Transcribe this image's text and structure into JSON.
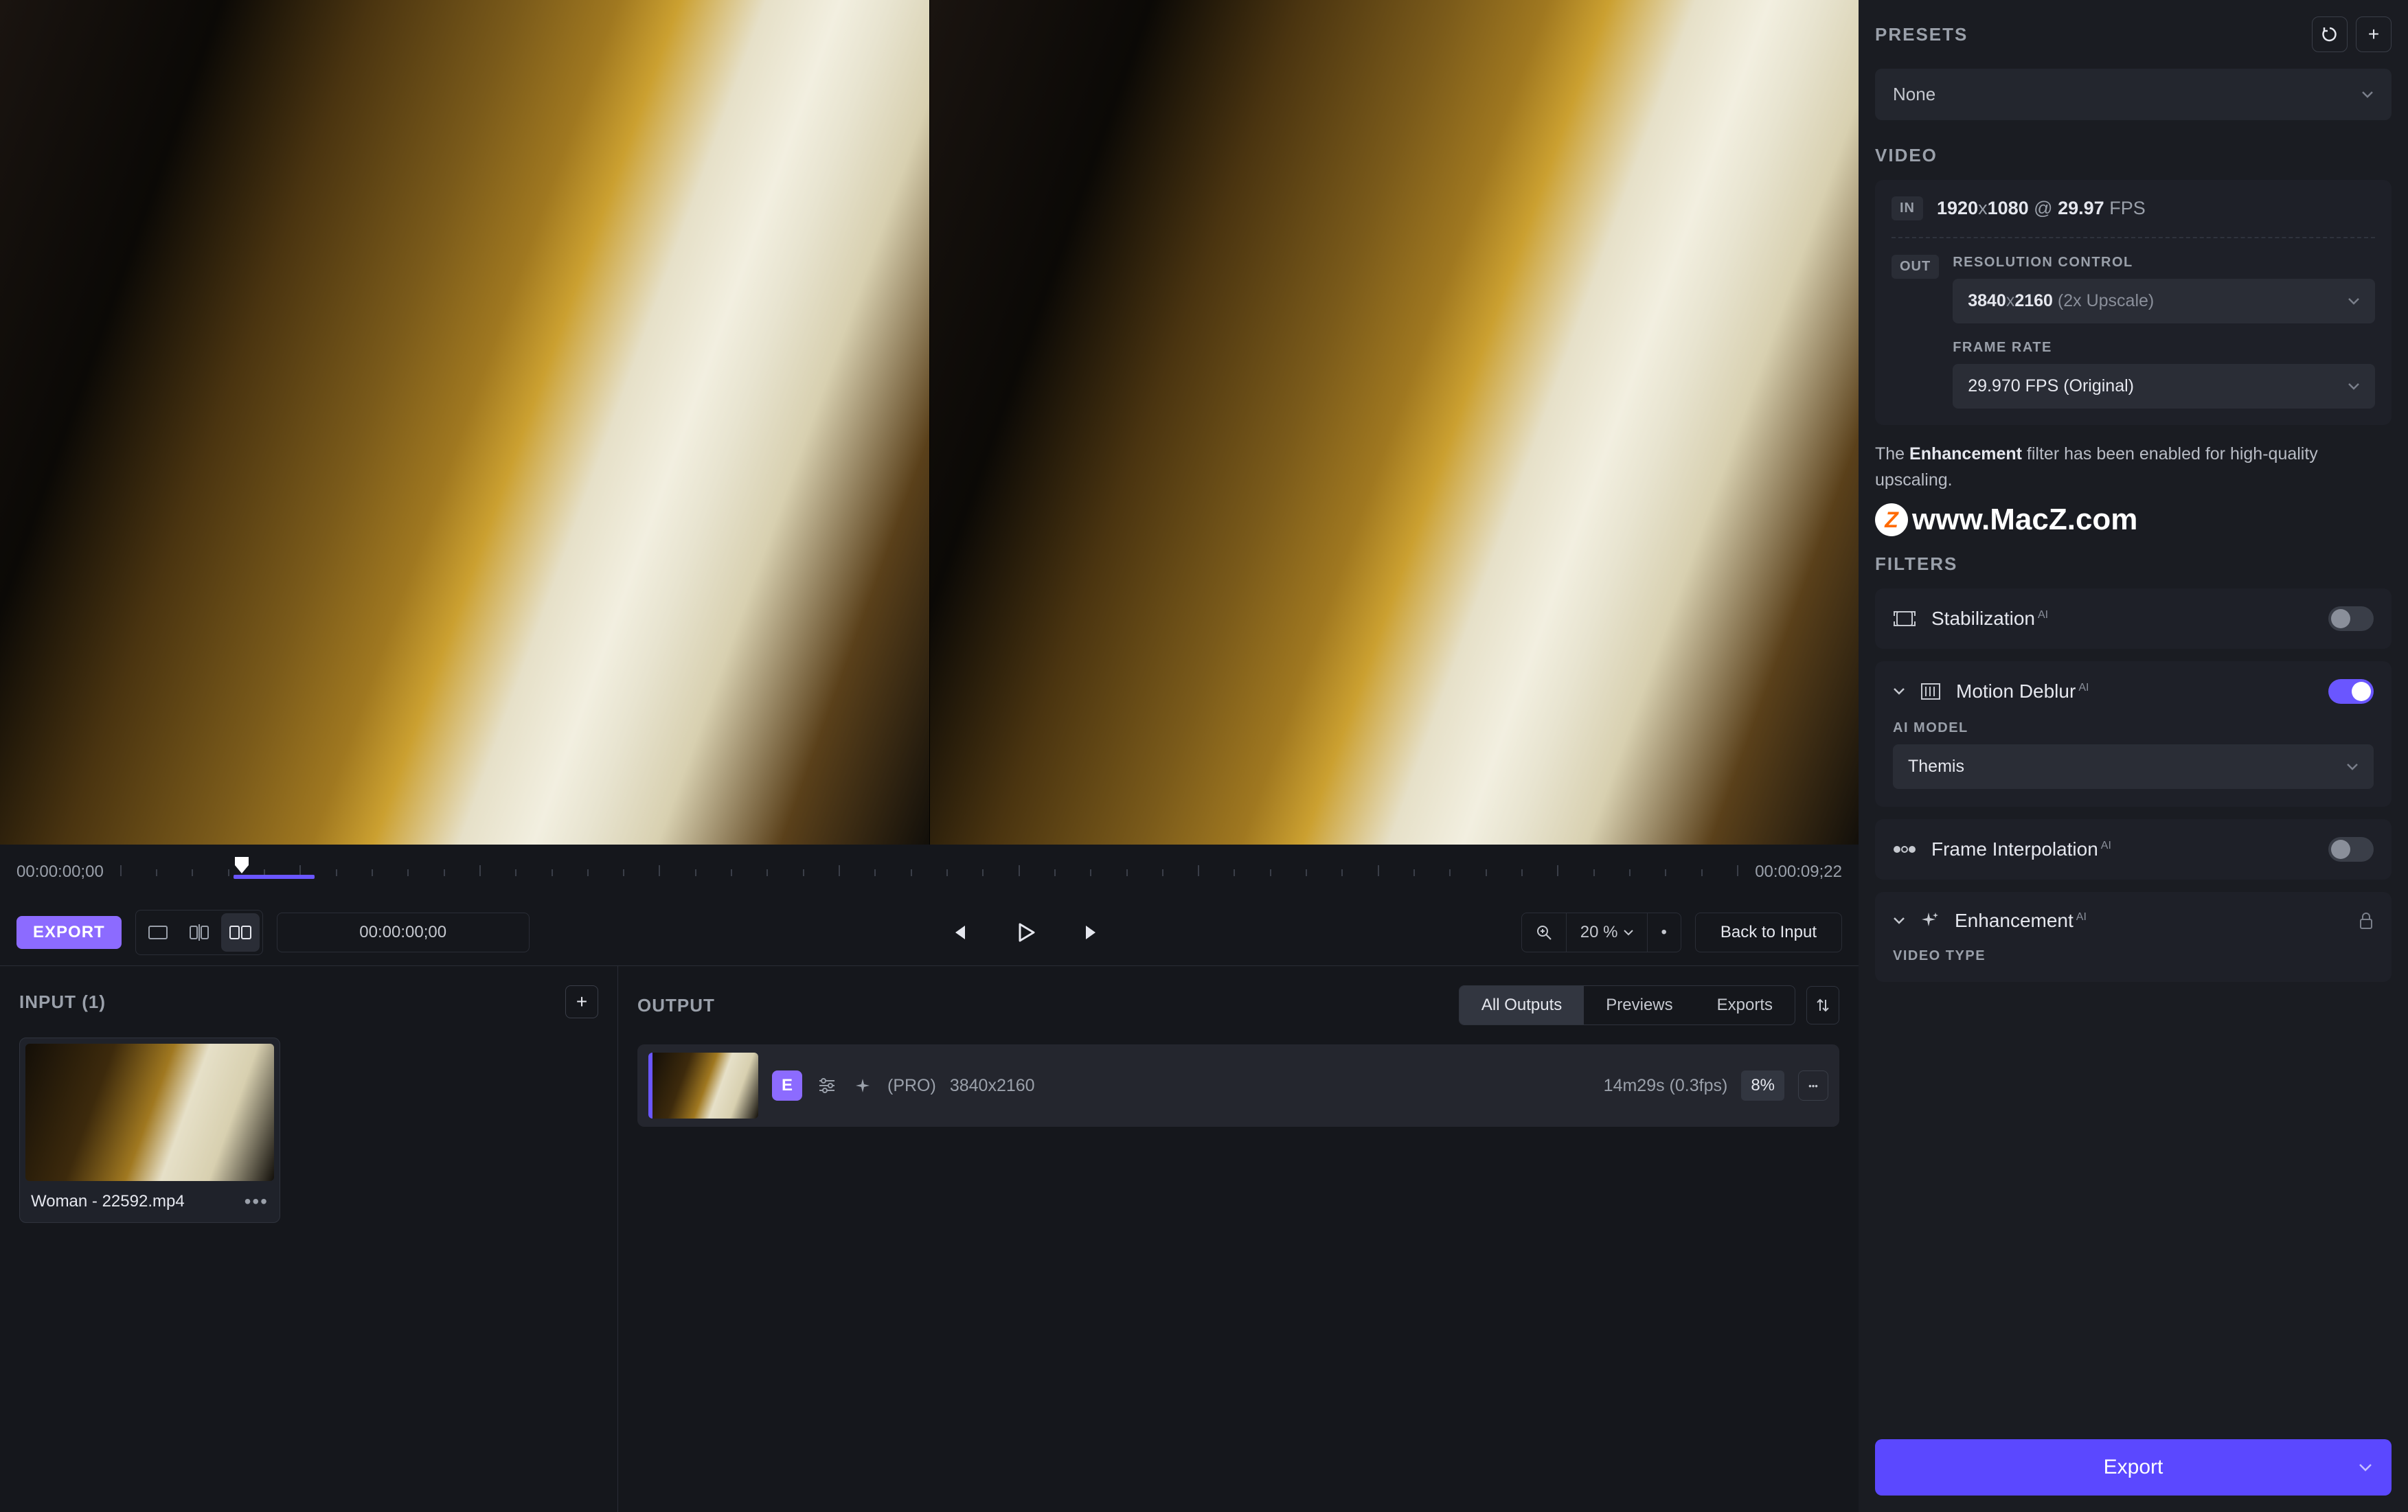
{
  "timeline": {
    "start": "00:00:00;00",
    "end": "00:00:09;22",
    "current": "00:00:00;00"
  },
  "transport": {
    "export_label": "EXPORT",
    "zoom_value": "20 %",
    "back_label": "Back to Input"
  },
  "input_panel": {
    "title": "INPUT (1)",
    "clip_name": "Woman - 22592.mp4"
  },
  "output_panel": {
    "title": "OUTPUT",
    "tabs": [
      "All Outputs",
      "Previews",
      "Exports"
    ],
    "row": {
      "badge": "E",
      "pro": "(PRO)",
      "resolution": "3840x2160",
      "eta": "14m29s (0.3fps)",
      "progress": "8%"
    }
  },
  "sidebar": {
    "presets": {
      "title": "PRESETS",
      "selected": "None"
    },
    "video": {
      "title": "VIDEO",
      "in_badge": "IN",
      "in_w": "1920",
      "in_h": "1080",
      "in_at": "@",
      "in_fps": "29.97",
      "in_fps_label": "FPS",
      "out_badge": "OUT",
      "res_label": "RESOLUTION CONTROL",
      "res_w": "3840",
      "res_h": "2160",
      "res_hint": "(2x Upscale)",
      "fr_label": "FRAME RATE",
      "fr_value": "29.970 FPS (Original)",
      "info_pre": "The ",
      "info_bold": "Enhancement",
      "info_post": " filter has been enabled for high-quality upscaling."
    },
    "watermark": "www.MacZ.com",
    "filters": {
      "title": "FILTERS",
      "stabilization": "Stabilization",
      "motion_deblur": "Motion Deblur",
      "ai_model_label": "AI MODEL",
      "ai_model_value": "Themis",
      "frame_interp": "Frame Interpolation",
      "enhancement": "Enhancement",
      "video_type_label": "VIDEO TYPE"
    },
    "export_label": "Export"
  }
}
